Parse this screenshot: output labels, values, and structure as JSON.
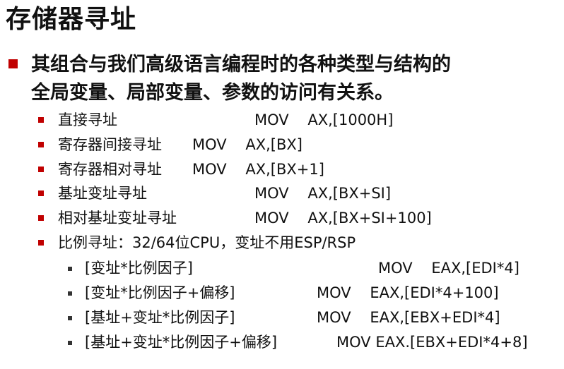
{
  "title": "存储器寻址",
  "lead": {
    "line1": "其组合与我们高级语言编程时的各种类型与结构的",
    "line2": "全局变量、局部变量、参数的访问有关系。"
  },
  "items": [
    {
      "desc": "直接寻址",
      "code": "MOV    AX,[1000H]"
    },
    {
      "desc": "寄存器间接寻址",
      "code": "MOV    AX,[BX]"
    },
    {
      "desc": "寄存器相对寻址",
      "code": "MOV    AX,[BX+1]"
    },
    {
      "desc": "基址变址寻址",
      "code": "MOV    AX,[BX+SI]"
    },
    {
      "desc": "相对基址变址寻址",
      "code": "MOV    AX,[BX+SI+100]"
    },
    {
      "desc": "比例寻址：32/64位CPU，变址不用ESP/RSP",
      "code": ""
    }
  ],
  "subitems": [
    {
      "desc": "[变址*比例因子]",
      "code": "MOV    EAX,[EDI*4]"
    },
    {
      "desc": "[变址*比例因子+偏移]",
      "code": "MOV    EAX,[EDI*4+100]"
    },
    {
      "desc": "[基址+变址*比例因子]",
      "code": "MOV    EAX,[EBX+EDI*4]"
    },
    {
      "desc": "[基址+变址*比例因子+偏移]",
      "code": "MOV EAX.[EBX+EDI*4+8]"
    }
  ],
  "colors": {
    "bullet_primary": "#c00000",
    "bullet_secondary": "#333333",
    "text": "#111111"
  }
}
